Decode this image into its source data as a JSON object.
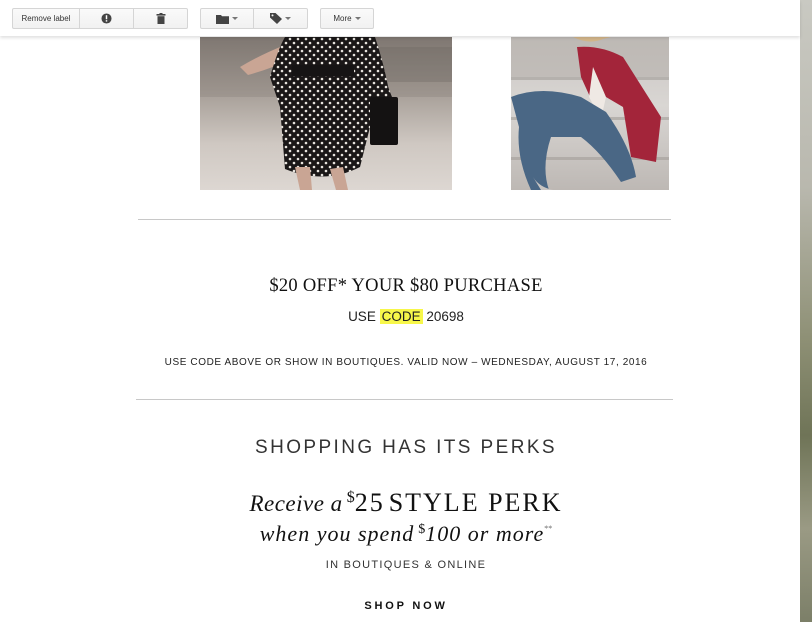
{
  "toolbar": {
    "remove_label": "Remove label",
    "more_label": "More",
    "report_spam_icon": "exclamation-circle-icon",
    "delete_icon": "trash-icon",
    "move_to_icon": "folder-icon",
    "labels_icon": "tag-icon"
  },
  "email": {
    "promo_title": "$20 OFF* YOUR $80 PURCHASE",
    "code_prefix": "USE",
    "code_word": "CODE",
    "code_number": "20698",
    "valid_text": "USE CODE ABOVE OR SHOW IN BOUTIQUES. VALID NOW – WEDNESDAY, AUGUST 17, 2016",
    "perks_heading": "SHOPPING HAS ITS PERKS",
    "perk_receive": "Receive a",
    "perk_dollar1": "$",
    "perk_amount1": "25",
    "perk_style": "STYLE PERK",
    "perk_when": "when you spend",
    "perk_dollar2": "$",
    "perk_amount2": "100 or more",
    "perk_asterisks": "**",
    "boutiques": "IN BOUTIQUES & ONLINE",
    "shop_now": "SHOP NOW"
  },
  "colors": {
    "highlight": "#f7f74a",
    "divider": "#c8c8c8"
  }
}
